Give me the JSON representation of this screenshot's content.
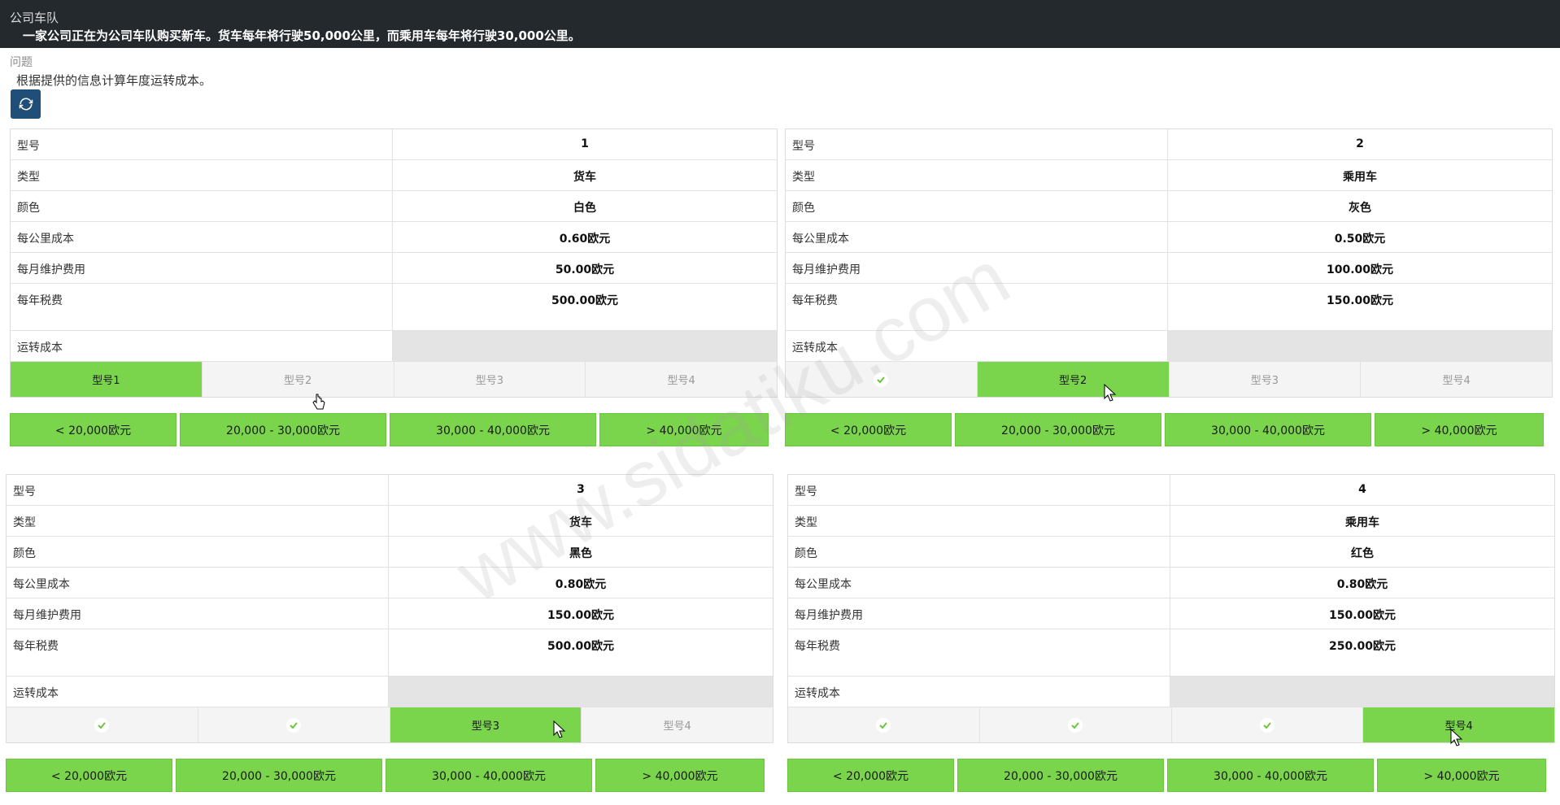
{
  "header": {
    "title": "公司车队",
    "description": "一家公司正在为公司车队购买新车。货车每年将行驶50,000公里，而乘用车每年将行驶30,000公里。"
  },
  "question": {
    "label": "问题",
    "text": "根据提供的信息计算年度运转成本。"
  },
  "refresh_icon": "refresh-icon",
  "labels": {
    "model": "型号",
    "type": "类型",
    "color": "颜色",
    "cost_per_km": "每公里成本",
    "monthly_maintenance": "每月维护费用",
    "annual_tax": "每年税费",
    "operating_cost": "运转成本"
  },
  "panels": [
    {
      "model": "1",
      "type": "货车",
      "color": "白色",
      "cost_per_km": "0.60欧元",
      "monthly_maintenance": "50.00欧元",
      "annual_tax": "500.00欧元",
      "operating_cost": "",
      "tabs": [
        "型号1",
        "型号2",
        "型号3",
        "型号4"
      ],
      "ranges": [
        "< 20,000欧元",
        "20,000 - 30,000欧元",
        "30,000 - 40,000欧元",
        "> 40,000欧元"
      ]
    },
    {
      "model": "2",
      "type": "乘用车",
      "color": "灰色",
      "cost_per_km": "0.50欧元",
      "monthly_maintenance": "100.00欧元",
      "annual_tax": "150.00欧元",
      "operating_cost": "",
      "tabs": [
        "",
        "型号2",
        "型号3",
        "型号4"
      ],
      "ranges": [
        "< 20,000欧元",
        "20,000 - 30,000欧元",
        "30,000 - 40,000欧元",
        "> 40,000欧元"
      ]
    },
    {
      "model": "3",
      "type": "货车",
      "color": "黑色",
      "cost_per_km": "0.80欧元",
      "monthly_maintenance": "150.00欧元",
      "annual_tax": "500.00欧元",
      "operating_cost": "",
      "tabs": [
        "",
        "",
        "型号3",
        "型号4"
      ],
      "ranges": [
        "< 20,000欧元",
        "20,000 - 30,000欧元",
        "30,000 - 40,000欧元",
        "> 40,000欧元"
      ]
    },
    {
      "model": "4",
      "type": "乘用车",
      "color": "红色",
      "cost_per_km": "0.80欧元",
      "monthly_maintenance": "150.00欧元",
      "annual_tax": "250.00欧元",
      "operating_cost": "",
      "tabs": [
        "",
        "",
        "",
        "型号4"
      ],
      "ranges": [
        "< 20,000欧元",
        "20,000 - 30,000欧元",
        "30,000 - 40,000欧元",
        "> 40,000欧元"
      ]
    }
  ],
  "watermark": "www.sidatiku.com",
  "colors": {
    "accent_green": "#7ad44c",
    "header_bg": "#24292d",
    "refresh_bg": "#1f4e79"
  }
}
